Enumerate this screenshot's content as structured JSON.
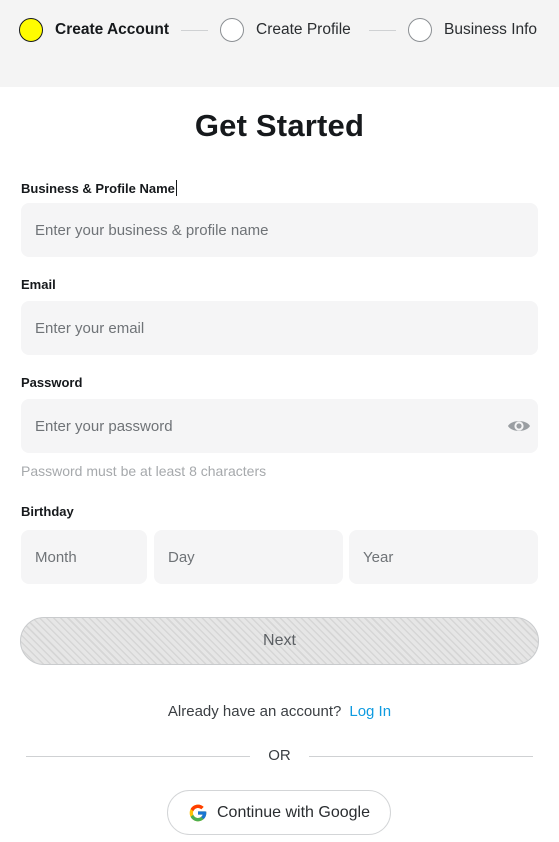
{
  "stepper": {
    "steps": [
      {
        "label": "Create Account",
        "active": true
      },
      {
        "label": "Create Profile",
        "active": false
      },
      {
        "label": "Business Info",
        "active": false
      }
    ]
  },
  "page_title": "Get Started",
  "form": {
    "business_name": {
      "label": "Business & Profile Name",
      "placeholder": "Enter your business & profile name",
      "value": ""
    },
    "email": {
      "label": "Email",
      "placeholder": "Enter your email",
      "value": ""
    },
    "password": {
      "label": "Password",
      "placeholder": "Enter your password",
      "value": "",
      "hint": "Password must be at least 8 characters",
      "toggle_icon": "eye-icon"
    },
    "birthday": {
      "label": "Birthday",
      "month_placeholder": "Month",
      "day_placeholder": "Day",
      "year_placeholder": "Year"
    },
    "next_label": "Next"
  },
  "login": {
    "prompt": "Already have an account?",
    "link_label": "Log In"
  },
  "divider_label": "OR",
  "google_button": {
    "label": "Continue with Google",
    "icon": "google-icon"
  },
  "colors": {
    "accent_yellow": "#fffc00",
    "link_blue": "#0f9be0",
    "field_bg": "#f5f5f6"
  }
}
